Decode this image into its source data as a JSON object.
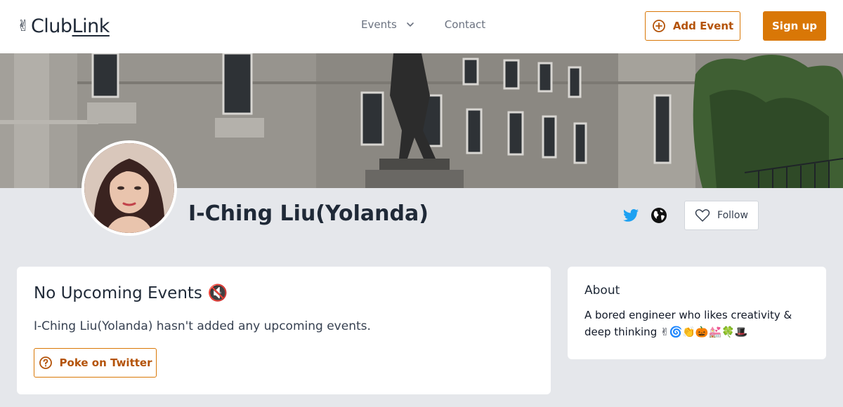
{
  "header": {
    "logo_emoji": "✌",
    "logo_text_club": "Club",
    "logo_text_link": "Link",
    "nav_events": "Events",
    "nav_contact": "Contact",
    "add_event": "Add Event",
    "sign_up": "Sign up"
  },
  "profile": {
    "name": "I-Ching Liu(Yolanda)",
    "follow": "Follow"
  },
  "events": {
    "title": "No Upcoming Events",
    "title_emoji": "🔇",
    "description": "I-Ching Liu(Yolanda) hasn't added any upcoming events.",
    "poke": "Poke on Twitter"
  },
  "about": {
    "title": "About",
    "text": "A bored engineer who likes creativity & deep thinking ✌🌀👏🎃💒🍀🎩"
  },
  "colors": {
    "accent": "#d97706",
    "accent_text": "#b45309",
    "twitter": "#1da1f2",
    "page_background": "#e5e7eb"
  },
  "icons": [
    "peace-hand-icon",
    "chevron-down-icon",
    "plus-circle-icon",
    "twitter-icon",
    "globe-icon",
    "heart-icon",
    "muted-speaker-icon",
    "question-circle-icon"
  ]
}
